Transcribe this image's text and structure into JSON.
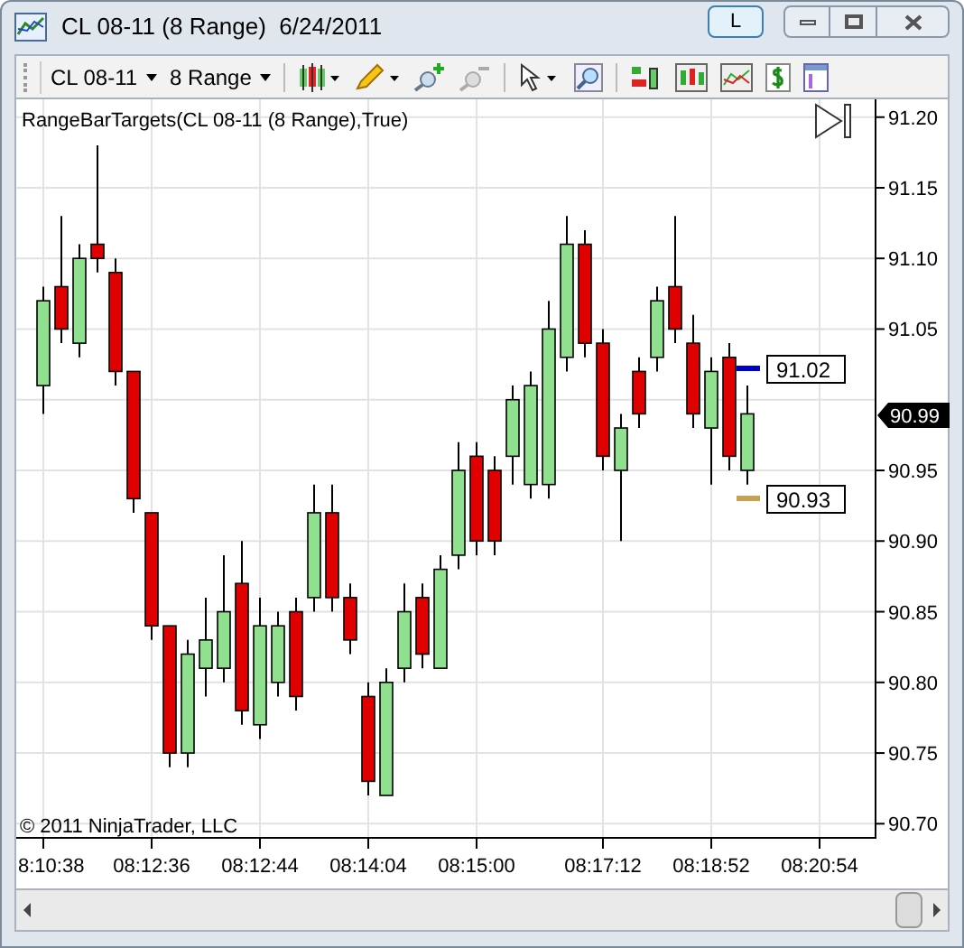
{
  "window": {
    "title": "CL 08-11 (8 Range)  6/24/2011",
    "link_button": "L"
  },
  "toolbar": {
    "instrument": "CL 08-11",
    "period": "8 Range"
  },
  "chart": {
    "indicator_label": "RangeBarTargets(CL 08-11 (8 Range),True)",
    "current_price": "90.99",
    "targets": [
      {
        "label": "91.02",
        "color": "#0000cc"
      },
      {
        "label": "90.93",
        "color": "#c8a050"
      }
    ],
    "copyright": "© 2011 NinjaTrader, LLC",
    "chart_data": {
      "type": "candlestick",
      "categories": [
        "8:10:38",
        null,
        null,
        null,
        null,
        null,
        "08:12:36",
        null,
        null,
        null,
        null,
        null,
        "08:12:44",
        null,
        null,
        null,
        null,
        null,
        "08:14:04",
        null,
        null,
        null,
        null,
        null,
        "08:15:00",
        null,
        null,
        null,
        null,
        null,
        null,
        "08:17:12",
        null,
        null,
        null,
        null,
        null,
        "08:18:52",
        null,
        null,
        null,
        null,
        null,
        "08:20:54"
      ],
      "ohlc": [
        [
          91.01,
          91.08,
          90.99,
          91.07
        ],
        [
          91.08,
          91.13,
          91.04,
          91.05
        ],
        [
          91.04,
          91.11,
          91.03,
          91.1
        ],
        [
          91.11,
          91.18,
          91.09,
          91.1
        ],
        [
          91.09,
          91.1,
          91.01,
          91.02
        ],
        [
          91.02,
          91.02,
          90.92,
          90.93
        ],
        [
          90.92,
          90.92,
          90.83,
          90.84
        ],
        [
          90.84,
          90.84,
          90.74,
          90.75
        ],
        [
          90.75,
          90.83,
          90.74,
          90.82
        ],
        [
          90.81,
          90.86,
          90.79,
          90.83
        ],
        [
          90.81,
          90.89,
          90.8,
          90.85
        ],
        [
          90.87,
          90.9,
          90.77,
          90.78
        ],
        [
          90.77,
          90.86,
          90.76,
          90.84
        ],
        [
          90.8,
          90.85,
          90.79,
          90.84
        ],
        [
          90.85,
          90.86,
          90.78,
          90.79
        ],
        [
          90.86,
          90.94,
          90.85,
          90.92
        ],
        [
          90.92,
          90.94,
          90.85,
          90.86
        ],
        [
          90.86,
          90.87,
          90.82,
          90.83
        ],
        [
          90.79,
          90.8,
          90.72,
          90.73
        ],
        [
          90.72,
          90.81,
          90.72,
          90.8
        ],
        [
          90.81,
          90.87,
          90.8,
          90.85
        ],
        [
          90.86,
          90.87,
          90.81,
          90.82
        ],
        [
          90.81,
          90.89,
          90.81,
          90.88
        ],
        [
          90.89,
          90.97,
          90.88,
          90.95
        ],
        [
          90.96,
          90.97,
          90.89,
          90.9
        ],
        [
          90.95,
          90.96,
          90.89,
          90.9
        ],
        [
          90.96,
          91.01,
          90.94,
          91.0
        ],
        [
          90.94,
          91.02,
          90.93,
          91.01
        ],
        [
          90.94,
          91.07,
          90.93,
          91.05
        ],
        [
          91.03,
          91.13,
          91.02,
          91.11
        ],
        [
          91.11,
          91.12,
          91.03,
          91.04
        ],
        [
          91.04,
          91.05,
          90.95,
          90.96
        ],
        [
          90.95,
          90.99,
          90.9,
          90.98
        ],
        [
          91.02,
          91.03,
          90.98,
          90.99
        ],
        [
          91.03,
          91.08,
          91.02,
          91.07
        ],
        [
          91.08,
          91.13,
          91.04,
          91.05
        ],
        [
          91.04,
          91.06,
          90.98,
          90.99
        ],
        [
          90.98,
          91.03,
          90.94,
          91.02
        ],
        [
          91.03,
          91.04,
          90.95,
          90.96
        ],
        [
          90.95,
          91.01,
          90.94,
          90.99
        ],
        null,
        null,
        null,
        null
      ],
      "ylim": [
        90.69,
        91.21
      ],
      "grid": true,
      "yticks": [
        {
          "value": 91.2,
          "label": "91.20"
        },
        {
          "value": 91.15,
          "label": "91.15"
        },
        {
          "value": 91.1,
          "label": "91.10"
        },
        {
          "value": 91.05,
          "label": "91.05"
        },
        {
          "value": 90.95,
          "label": "90.95"
        },
        {
          "value": 90.9,
          "label": "90.90"
        },
        {
          "value": 90.85,
          "label": "90.85"
        },
        {
          "value": 90.8,
          "label": "90.80"
        },
        {
          "value": 90.75,
          "label": "90.75"
        },
        {
          "value": 90.7,
          "label": "90.70"
        }
      ]
    }
  }
}
